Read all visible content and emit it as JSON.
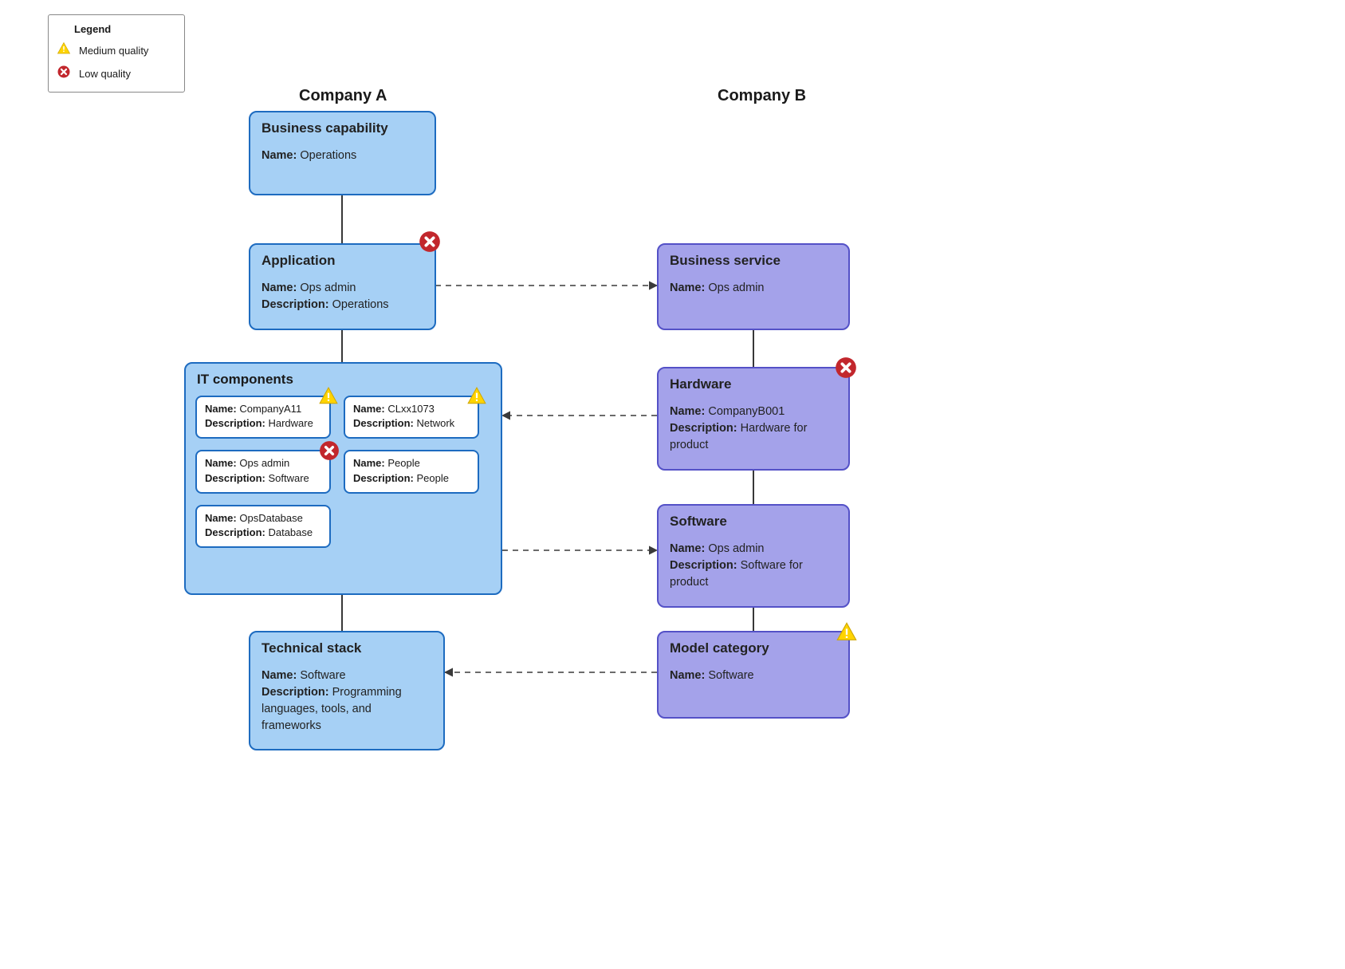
{
  "legend": {
    "title": "Legend",
    "medium": "Medium quality",
    "low": "Low quality"
  },
  "headings": {
    "companyA": "Company A",
    "companyB": "Company B"
  },
  "labels": {
    "name": "Name:",
    "description": "Description:"
  },
  "companyA": {
    "business_capability": {
      "title": "Business capability",
      "name": "Operations"
    },
    "application": {
      "title": "Application",
      "name": "Ops admin",
      "description": "Operations",
      "quality": "low"
    },
    "it_components": {
      "title": "IT components",
      "items": [
        {
          "name": "CompanyA11",
          "description": "Hardware",
          "quality": "medium"
        },
        {
          "name": "CLxx1073",
          "description": "Network",
          "quality": "medium"
        },
        {
          "name": "Ops admin",
          "description": "Software",
          "quality": "low"
        },
        {
          "name": "People",
          "description": "People"
        },
        {
          "name": "OpsDatabase",
          "description": "Database"
        }
      ]
    },
    "technical_stack": {
      "title": "Technical stack",
      "name": "Software",
      "description": "Programming languages, tools, and frameworks"
    }
  },
  "companyB": {
    "business_service": {
      "title": "Business service",
      "name": "Ops admin"
    },
    "hardware": {
      "title": "Hardware",
      "name": "CompanyB001",
      "description": "Hardware for product",
      "quality": "low"
    },
    "software": {
      "title": "Software",
      "name": "Ops admin",
      "description": "Software for product"
    },
    "model_category": {
      "title": "Model category",
      "name": "Software",
      "quality": "medium"
    }
  },
  "colors": {
    "companyA_fill": "#a6d0f5",
    "companyA_stroke": "#1d6bc0",
    "companyB_fill": "#a4a2ea",
    "companyB_stroke": "#5451c7",
    "low_quality": "#c2272d",
    "medium_quality": "#ffd400"
  },
  "chart_data": {
    "type": "diagram",
    "nodes": [
      {
        "id": "A_bc",
        "company": "A",
        "title": "Business capability",
        "name": "Operations"
      },
      {
        "id": "A_app",
        "company": "A",
        "title": "Application",
        "name": "Ops admin",
        "description": "Operations",
        "quality": "low"
      },
      {
        "id": "A_it",
        "company": "A",
        "title": "IT components",
        "children": [
          {
            "id": "A_it_hw",
            "name": "CompanyA11",
            "description": "Hardware",
            "quality": "medium"
          },
          {
            "id": "A_it_net",
            "name": "CLxx1073",
            "description": "Network",
            "quality": "medium"
          },
          {
            "id": "A_it_sw",
            "name": "Ops admin",
            "description": "Software",
            "quality": "low"
          },
          {
            "id": "A_it_people",
            "name": "People",
            "description": "People"
          },
          {
            "id": "A_it_db",
            "name": "OpsDatabase",
            "description": "Database"
          }
        ]
      },
      {
        "id": "A_ts",
        "company": "A",
        "title": "Technical stack",
        "name": "Software",
        "description": "Programming languages, tools, and frameworks"
      },
      {
        "id": "B_bs",
        "company": "B",
        "title": "Business service",
        "name": "Ops admin"
      },
      {
        "id": "B_hw",
        "company": "B",
        "title": "Hardware",
        "name": "CompanyB001",
        "description": "Hardware for product",
        "quality": "low"
      },
      {
        "id": "B_sw",
        "company": "B",
        "title": "Software",
        "name": "Ops admin",
        "description": "Software for product"
      },
      {
        "id": "B_mc",
        "company": "B",
        "title": "Model category",
        "name": "Software",
        "quality": "medium"
      }
    ],
    "edges": [
      {
        "from": "A_bc",
        "to": "A_app",
        "style": "solid"
      },
      {
        "from": "A_app",
        "to": "A_it",
        "style": "solid"
      },
      {
        "from": "A_it",
        "to": "A_ts",
        "style": "solid"
      },
      {
        "from": "B_bs",
        "to": "B_hw",
        "style": "solid"
      },
      {
        "from": "B_hw",
        "to": "B_sw",
        "style": "solid"
      },
      {
        "from": "B_sw",
        "to": "B_mc",
        "style": "solid"
      },
      {
        "from": "A_app",
        "to": "B_bs",
        "style": "dashed",
        "arrow": "to"
      },
      {
        "from": "B_hw",
        "to": "A_it_net",
        "style": "dashed",
        "arrow": "to"
      },
      {
        "from": "A_it",
        "to": "B_sw",
        "style": "dashed",
        "arrow": "to"
      },
      {
        "from": "B_mc",
        "to": "A_ts",
        "style": "dashed",
        "arrow": "to"
      }
    ]
  }
}
